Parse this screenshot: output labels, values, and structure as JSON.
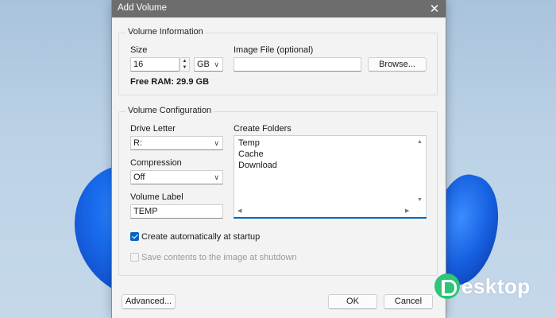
{
  "window": {
    "title": "Add Volume"
  },
  "volume_information": {
    "group_label": "Volume Information",
    "size_label": "Size",
    "size_value": "16",
    "unit_value": "GB",
    "free_ram_label": "Free RAM: 29.9 GB",
    "image_file_label": "Image File (optional)",
    "image_file_value": "",
    "browse_label": "Browse..."
  },
  "volume_configuration": {
    "group_label": "Volume Configuration",
    "drive_letter_label": "Drive Letter",
    "drive_letter_value": "R:",
    "compression_label": "Compression",
    "compression_value": "Off",
    "volume_label_label": "Volume Label",
    "volume_label_value": "TEMP",
    "create_folders_label": "Create Folders",
    "folders": [
      "Temp",
      "Cache",
      "Download"
    ],
    "create_startup_label": "Create automatically at startup",
    "create_startup_checked": true,
    "save_contents_label": "Save contents to the image at shutdown",
    "save_contents_checked": false
  },
  "footer": {
    "advanced_label": "Advanced...",
    "ok_label": "OK",
    "cancel_label": "Cancel"
  },
  "watermark": {
    "text": "esktop"
  },
  "colors": {
    "accent": "#0067c0",
    "titlebar": "#6d6d6d",
    "dialog_bg": "#f3f3f3"
  }
}
